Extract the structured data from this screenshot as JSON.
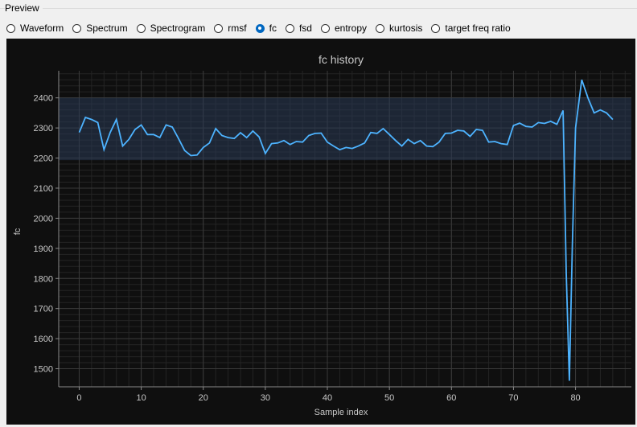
{
  "preview": {
    "title": "Preview",
    "options": [
      {
        "label": "Waveform",
        "checked": false
      },
      {
        "label": "Spectrum",
        "checked": false
      },
      {
        "label": "Spectrogram",
        "checked": false
      },
      {
        "label": "rmsf",
        "checked": false
      },
      {
        "label": "fc",
        "checked": true
      },
      {
        "label": "fsd",
        "checked": false
      },
      {
        "label": "entropy",
        "checked": false
      },
      {
        "label": "kurtosis",
        "checked": false
      },
      {
        "label": "target freq ratio",
        "checked": false
      }
    ]
  },
  "colors": {
    "line": "#4db3ff",
    "band": "#2a3a55",
    "background": "#0f0f0f",
    "grid": "#3a3a3a",
    "text": "#c8c8c8"
  },
  "chart_data": {
    "type": "line",
    "title": "fc history",
    "xlabel": "Sample index",
    "ylabel": "fc",
    "xlim": [
      -3.3,
      89
    ],
    "ylim": [
      1440,
      2490
    ],
    "xticks": [
      0,
      10,
      20,
      30,
      40,
      50,
      60,
      70,
      80
    ],
    "yticks": [
      1500,
      1600,
      1700,
      1800,
      1900,
      2000,
      2100,
      2200,
      2300,
      2400
    ],
    "grid": true,
    "band": [
      2193,
      2400
    ],
    "x": [
      0,
      1,
      2,
      3,
      4,
      5,
      6,
      7,
      8,
      9,
      10,
      11,
      12,
      13,
      14,
      15,
      16,
      17,
      18,
      19,
      20,
      21,
      22,
      23,
      24,
      25,
      26,
      27,
      28,
      29,
      30,
      31,
      32,
      33,
      34,
      35,
      36,
      37,
      38,
      39,
      40,
      41,
      42,
      43,
      44,
      45,
      46,
      47,
      48,
      49,
      50,
      51,
      52,
      53,
      54,
      55,
      56,
      57,
      58,
      59,
      60,
      61,
      62,
      63,
      64,
      65,
      66,
      67,
      68,
      69,
      70,
      71,
      72,
      73,
      74,
      75,
      76,
      77,
      78,
      78.5,
      79,
      79.5,
      80,
      81,
      82,
      83,
      84,
      85,
      86
    ],
    "y": [
      2285,
      2335,
      2328,
      2318,
      2228,
      2285,
      2328,
      2240,
      2262,
      2295,
      2310,
      2278,
      2278,
      2268,
      2310,
      2303,
      2265,
      2225,
      2208,
      2210,
      2235,
      2250,
      2298,
      2275,
      2268,
      2265,
      2284,
      2268,
      2290,
      2270,
      2215,
      2248,
      2250,
      2258,
      2245,
      2255,
      2253,
      2275,
      2282,
      2283,
      2253,
      2240,
      2228,
      2235,
      2232,
      2240,
      2250,
      2285,
      2282,
      2298,
      2278,
      2258,
      2240,
      2262,
      2248,
      2258,
      2240,
      2238,
      2253,
      2282,
      2283,
      2292,
      2290,
      2272,
      2295,
      2292,
      2253,
      2255,
      2248,
      2245,
      2308,
      2316,
      2305,
      2303,
      2318,
      2315,
      2322,
      2312,
      2358,
      1820,
      1460,
      1920,
      2300,
      2460,
      2400,
      2350,
      2360,
      2350,
      2328
    ]
  }
}
